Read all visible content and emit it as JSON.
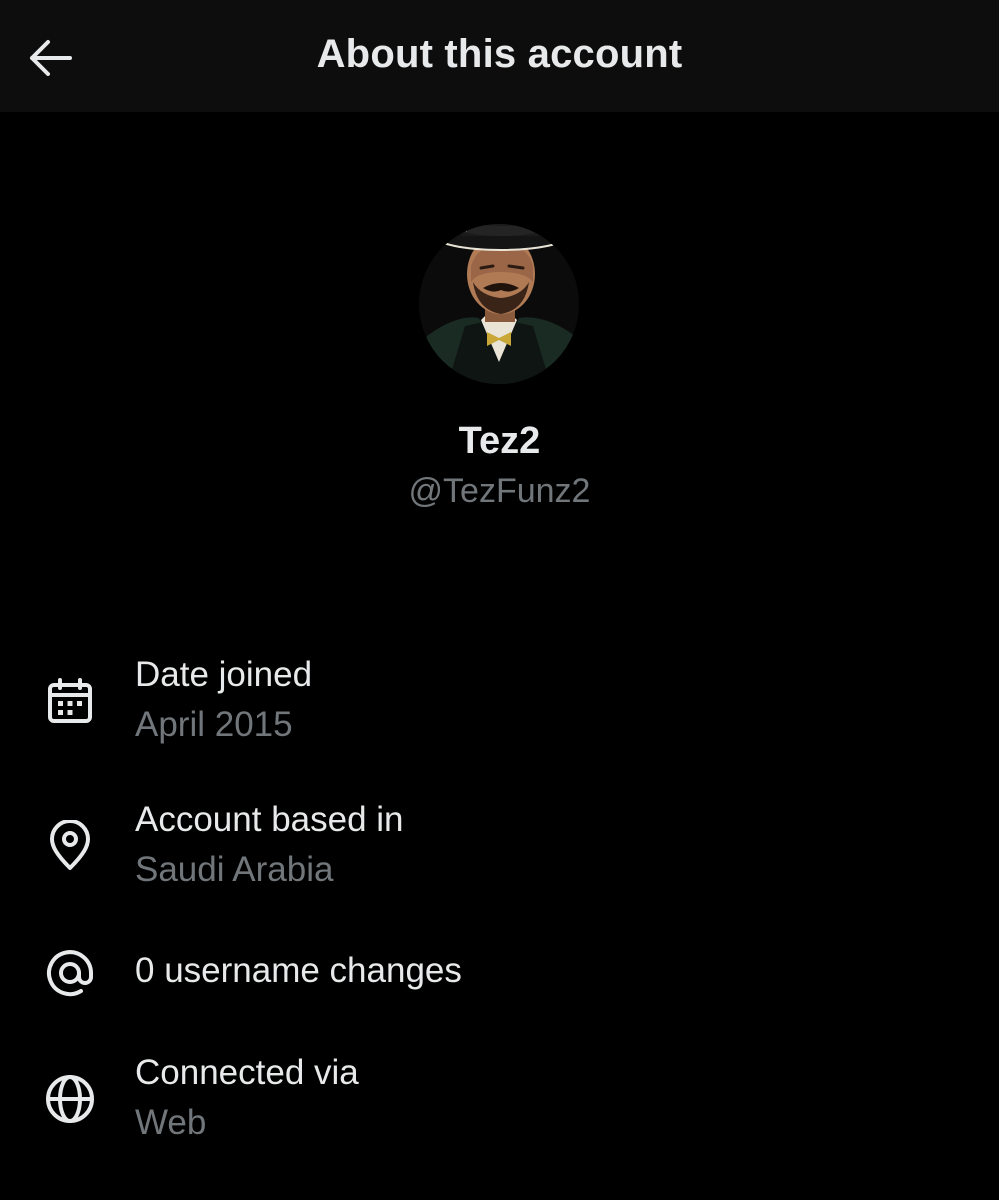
{
  "header": {
    "title": "About this account",
    "back_icon": "arrow-left-icon"
  },
  "profile": {
    "display_name": "Tez2",
    "handle": "@TezFunz2"
  },
  "details": [
    {
      "icon": "calendar-icon",
      "title": "Date joined",
      "value": "April 2015"
    },
    {
      "icon": "location-pin-icon",
      "title": "Account based in",
      "value": "Saudi Arabia"
    },
    {
      "icon": "at-sign-icon",
      "title": "0 username changes",
      "value": ""
    },
    {
      "icon": "globe-icon",
      "title": "Connected via",
      "value": "Web"
    }
  ],
  "colors": {
    "background": "#000000",
    "header_background": "#0d0d0d",
    "primary_text": "#e7e9ea",
    "secondary_text": "#71767b"
  }
}
